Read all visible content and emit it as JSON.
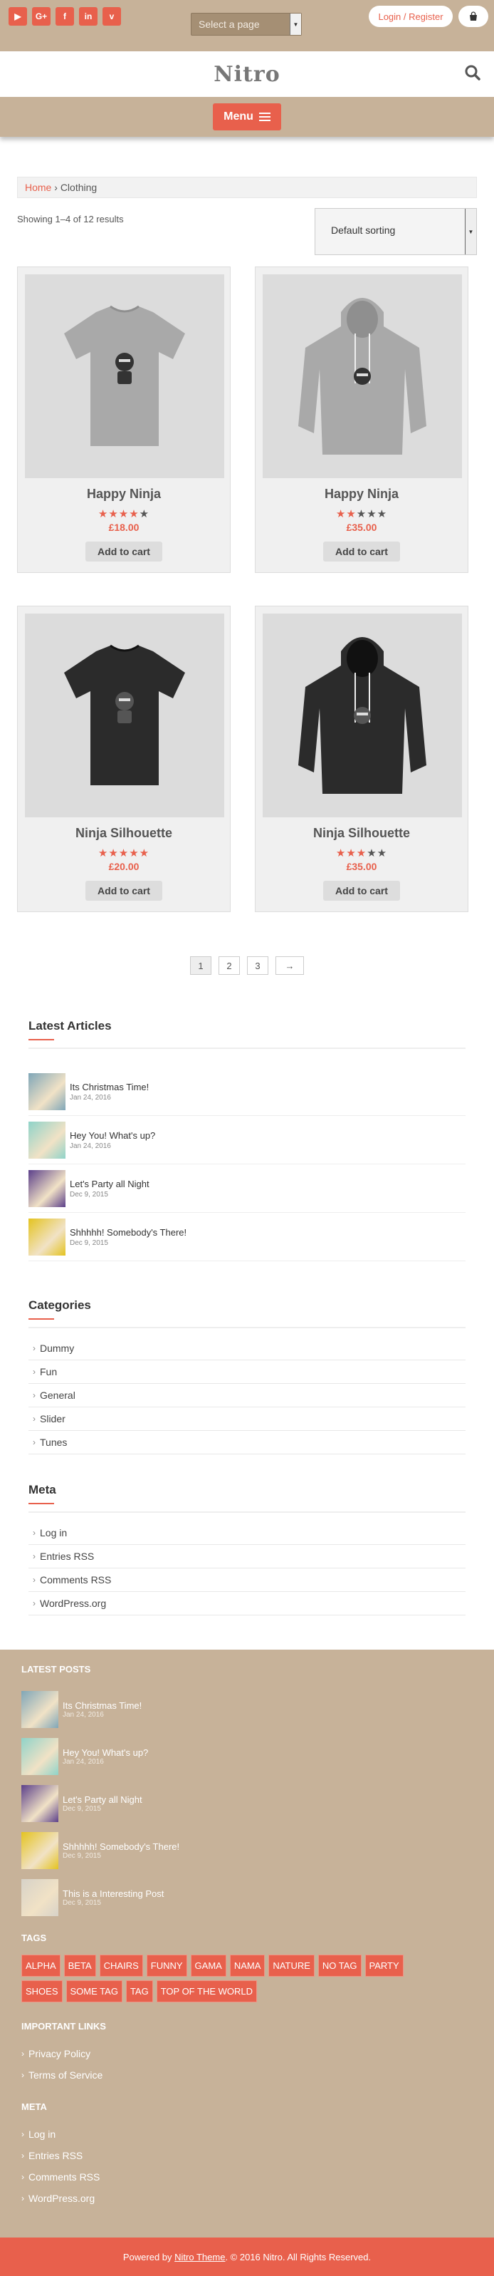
{
  "topbar": {
    "social": [
      {
        "icon": "youtube-icon",
        "glyph": "▶"
      },
      {
        "icon": "google-plus-icon",
        "glyph": "G+"
      },
      {
        "icon": "facebook-icon",
        "glyph": "f"
      },
      {
        "icon": "linkedin-icon",
        "glyph": "in"
      },
      {
        "icon": "vimeo-icon",
        "glyph": "v"
      }
    ],
    "page_select": "Select a page",
    "login": "Login / Register"
  },
  "header": {
    "logo": "Nitro"
  },
  "nav": {
    "menu_label": "Menu"
  },
  "breadcrumb": {
    "home": "Home",
    "sep": "›",
    "current": "Clothing"
  },
  "shop": {
    "result_count": "Showing 1–4 of 12 results",
    "sort": "Default sorting",
    "products": [
      {
        "name": "Happy Ninja",
        "price": "£18.00",
        "rating": 4,
        "cta": "Add to cart",
        "kind": "tshirt",
        "color": "grey"
      },
      {
        "name": "Happy Ninja",
        "price": "£35.00",
        "rating": 2,
        "cta": "Add to cart",
        "kind": "hoodie",
        "color": "grey"
      },
      {
        "name": "Ninja Silhouette",
        "price": "£20.00",
        "rating": 5,
        "cta": "Add to cart",
        "kind": "tshirt",
        "color": "black"
      },
      {
        "name": "Ninja Silhouette",
        "price": "£35.00",
        "rating": 3,
        "cta": "Add to cart",
        "kind": "hoodie",
        "color": "black"
      }
    ],
    "pagination": [
      "1",
      "2",
      "3",
      "→"
    ]
  },
  "sidebar": {
    "latest_title": "Latest Articles",
    "articles": [
      {
        "title": "Its Christmas Time!",
        "date": "Jan 24, 2016",
        "thumb": "#7fa6b8"
      },
      {
        "title": "Hey You! What's up?",
        "date": "Jan 24, 2016",
        "thumb": "#8fd3c9"
      },
      {
        "title": "Let's Party all Night",
        "date": "Dec 9, 2015",
        "thumb": "#5b3f8a"
      },
      {
        "title": "Shhhhh! Somebody's There!",
        "date": "Dec 9, 2015",
        "thumb": "#e4c31f"
      }
    ],
    "categories_title": "Categories",
    "categories": [
      "Dummy",
      "Fun",
      "General",
      "Slider",
      "Tunes"
    ],
    "meta_title": "Meta",
    "meta": [
      "Log in",
      "Entries RSS",
      "Comments RSS",
      "WordPress.org"
    ]
  },
  "footer": {
    "latest_title": "LATEST POSTS",
    "posts": [
      {
        "title": "Its Christmas Time!",
        "date": "Jan 24, 2016",
        "thumb": "#7fa6b8"
      },
      {
        "title": "Hey You! What's up?",
        "date": "Jan 24, 2016",
        "thumb": "#8fd3c9"
      },
      {
        "title": "Let's Party all Night",
        "date": "Dec 9, 2015",
        "thumb": "#5b3f8a"
      },
      {
        "title": "Shhhhh! Somebody's There!",
        "date": "Dec 9, 2015",
        "thumb": "#e4c31f"
      },
      {
        "title": "This is a Interesting Post",
        "date": "Dec 9, 2015",
        "thumb": "#d7d2c8"
      }
    ],
    "tags_title": "TAGS",
    "tags": [
      "ALPHA",
      "BETA",
      "CHAIRS",
      "FUNNY",
      "GAMA",
      "NAMA",
      "NATURE",
      "NO TAG",
      "PARTY",
      "SHOES",
      "SOME TAG",
      "TAG",
      "TOP OF THE WORLD"
    ],
    "links_title": "IMPORTANT LINKS",
    "links": [
      "Privacy Policy",
      "Terms of Service"
    ],
    "meta_title": "META",
    "meta": [
      "Log in",
      "Entries RSS",
      "Comments RSS",
      "WordPress.org"
    ],
    "copyright_pre": "Powered by",
    "copyright_link": "Nitro Theme",
    "copyright_post": ". © 2016 Nitro. All Rights Reserved."
  },
  "colors": {
    "accent": "#e8604c",
    "tan": "#c7b299",
    "star_on": "#e8604c",
    "star_off": "#555555"
  }
}
